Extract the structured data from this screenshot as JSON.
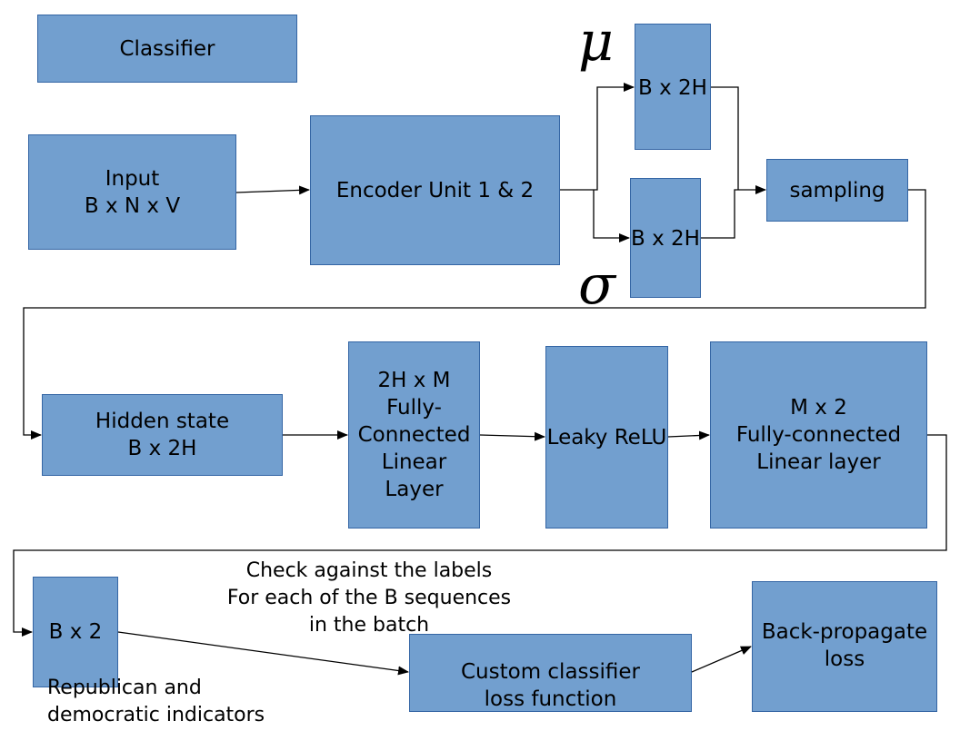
{
  "diagram": {
    "title_box": "Classifier",
    "nodes": {
      "input": "Input\nB x N x V",
      "encoder": "Encoder Unit 1 & 2",
      "mu_vec": "B x 2H",
      "sigma_vec": "B x 2H",
      "sampling": "sampling",
      "hidden": "Hidden state\nB x 2H",
      "fc1": "2H x M\nFully-\nConnected\nLinear\nLayer",
      "relu": "Leaky ReLU",
      "fc2": "M x 2\nFully-connected\nLinear layer",
      "output": "B x 2",
      "loss": "Custom classifier\nloss function",
      "backprop": "Back-propagate\nloss"
    },
    "symbols": {
      "mu": "μ",
      "sigma": "σ"
    },
    "annotations": {
      "check_labels": "Check against the labels\nFor each of the B sequences\nin the batch",
      "indicators": "Republican and\ndemocratic indicators"
    },
    "colors": {
      "box_fill": "#729fcf",
      "box_border": "#3465a4",
      "line": "#000000"
    }
  }
}
